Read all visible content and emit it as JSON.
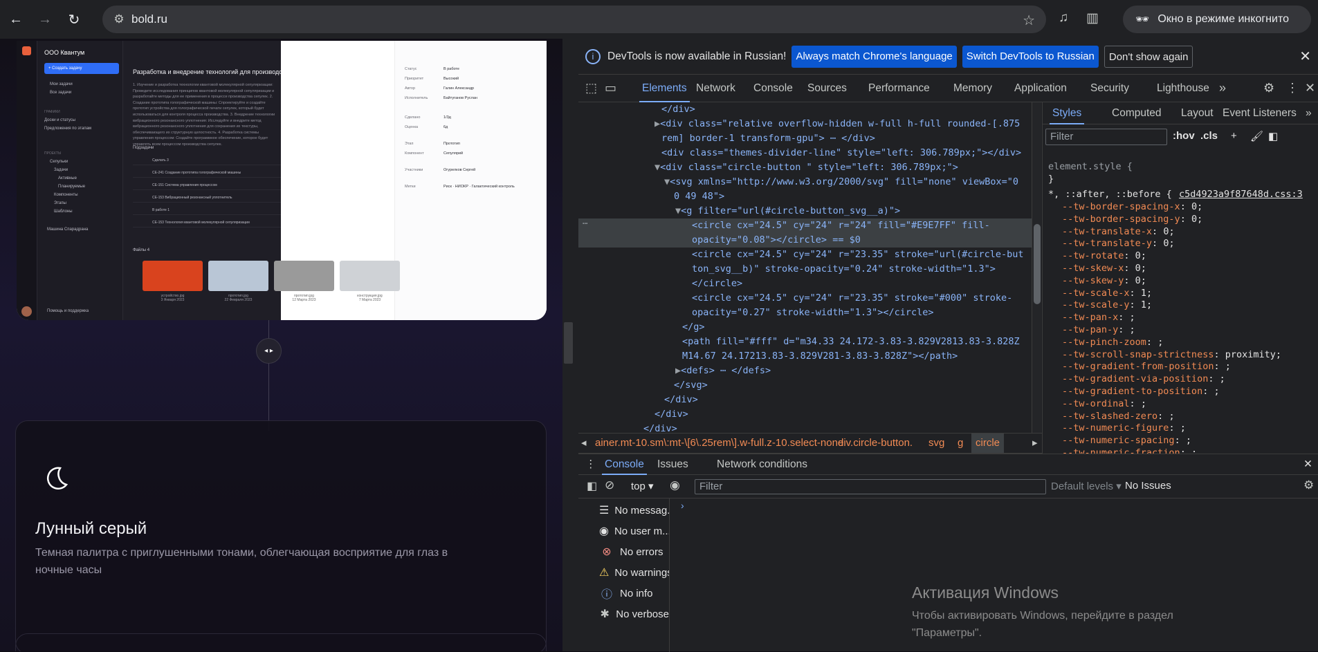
{
  "browser": {
    "url": "bold.ru",
    "incognito_label": "Окно в режиме инкогнито"
  },
  "page": {
    "preview": {
      "org_name": "ООО Квантум",
      "create_task": "+ Создать задачу",
      "sidebar_items": [
        "Мои задачи",
        "Все задачи"
      ],
      "sidebar_sec1": "ГРАФИКИ",
      "sidebar_items2": [
        "Доски и статусы",
        "Предложения по этапам"
      ],
      "sidebar_sec2": "ПРОЕКТЫ",
      "sidebar_items3": [
        "Сепульки",
        "Задачи",
        "Активные",
        "Планируемые",
        "Компоненты",
        "Этапы",
        "Шаблоны",
        "Машина Спарадрана"
      ],
      "task_title": "Разработка и внедрение технологий для производства сепулек в сепуляриях",
      "task_text": "1. Изучение и разработка технологии квантовой молекулярной сепуляризации: Проведите исследования принципов квантовой молекулярной сепуляризации и разработайте методы для ее применения в процессе производства сепулек. 2. Создание прототипа голографической машины: Спроектируйте и создайте прототип устройства для голографической печати сепулек, который будет использоваться для контроля процесса производства. 3. Внедрение технологии вибрационного резонансного уплотнения: Исследуйте и внедрите метод вибрационного резонансного уплотнения для сохранения их текстуры, обеспечивающего их структурную целостность. 4. Разработка системы управления процессом: Создайте программное обеспечение, которое будет управлять всем процессом производства сепулек.",
      "subtasks_label": "Подзадачи",
      "subtasks": [
        "Сделать 3",
        "СЕ-241  Создание прототипа голографической машины",
        "СЕ-151  Система управления процессом",
        "СЕ-153  Вибрационный резонансный уплотнитель",
        "В работе 1",
        "СЕ-153  Технология квантовой молекулярной сепуляризации"
      ],
      "files_label": "Файлы 4",
      "files": [
        {
          "name": "устройство.jpg",
          "date": "3 Января 2023",
          "color": "#d9431e"
        },
        {
          "name": "прототип.jpg",
          "date": "22 Февраля 2023",
          "color": "#b9c6d6"
        },
        {
          "name": "прототип.jpg",
          "date": "12 Марта 2023",
          "color": "#9a9a9a"
        },
        {
          "name": "конструкция.jpg",
          "date": "7 Марта 2023",
          "color": "#cfd2d6"
        }
      ],
      "props": [
        {
          "k": "Статус",
          "v": "В работе"
        },
        {
          "k": "Приоритет",
          "v": "Высокий"
        },
        {
          "k": "Автор",
          "v": "Галин Александр"
        },
        {
          "k": "Исполнитель",
          "v": "Байтуганов Руслан"
        },
        {
          "k": "Сделано",
          "v": "1/3д"
        },
        {
          "k": "Оценка",
          "v": "6д"
        },
        {
          "k": "Этап",
          "v": "Прототип"
        },
        {
          "k": "Компонент",
          "v": "Сепулярий"
        },
        {
          "k": "Участники",
          "v": "Огурелков Сергей"
        },
        {
          "k": "Метки",
          "v": "Риск · НИОКР · Галактический контроль"
        }
      ],
      "support": "Помощь и поддержка"
    },
    "theme_card": {
      "title": "Лунный серый",
      "description": "Темная палитра с приглушенными тонами, облегчающая восприятие для глаз в ночные часы"
    }
  },
  "devtools": {
    "infobar": {
      "message": "DevTools is now available in Russian!",
      "btn_match": "Always match Chrome's language",
      "btn_switch": "Switch DevTools to Russian",
      "btn_dismiss": "Don't show again"
    },
    "tabs": [
      "Elements",
      "Network",
      "Console",
      "Sources",
      "Performance",
      "Memory",
      "Application",
      "Security",
      "Lighthouse"
    ],
    "active_tab": "Elements",
    "dom_lines": [
      "</div>",
      "<div class=\"relative overflow-hidden w-full h-full rounded-[.875",
      "rem] border-1 transform-gpu\"> ⋯ </div>",
      "<div class=\"themes-divider-line\" style=\"left: 306.789px;\"></div>",
      "<div class=\"circle-button \" style=\"left: 306.789px;\">",
      "<svg xmlns=\"http://www.w3.org/2000/svg\" fill=\"none\" viewBox=\"0",
      "0 49 48\">",
      "<g filter=\"url(#circle-button_svg__a)\">",
      "<circle cx=\"24.5\" cy=\"24\" r=\"24\" fill=\"#E9E7FF\" fill-",
      "opacity=\"0.08\"></circle> == $0",
      "<circle cx=\"24.5\" cy=\"24\" r=\"23.35\" stroke=\"url(#circle-but",
      "ton_svg__b)\" stroke-opacity=\"0.24\" stroke-width=\"1.3\">",
      "</circle>",
      "<circle cx=\"24.5\" cy=\"24\" r=\"23.35\" stroke=\"#000\" stroke-",
      "opacity=\"0.27\" stroke-width=\"1.3\"></circle>",
      "</g>",
      "<path fill=\"#fff\" d=\"m34.33 24.172-3.83-3.829V2813.83-3.828Z",
      "M14.67 24.17213.83-3.829V281-3.83-3.828Z\"></path>",
      "<defs> ⋯ </defs>",
      "</svg>",
      "</div>",
      "</div>",
      "</div>"
    ],
    "breadcrumbs": [
      "ainer.mt-10.sm\\:mt-\\[6\\.25rem\\].w-full.z-10.select-none",
      "div.circle-button.",
      "svg",
      "g",
      "circle"
    ],
    "styles": {
      "tabs": [
        "Styles",
        "Computed",
        "Layout",
        "Event Listeners"
      ],
      "filter_placeholder": "Filter",
      "hov": ":hov",
      "cls": ".cls",
      "element_style": "element.style {",
      "element_close": "}",
      "selector": "*, ::after, ::before {",
      "source": "c5d4923a9f87648d.css:3",
      "props": [
        [
          "--tw-border-spacing-x",
          "0;"
        ],
        [
          "--tw-border-spacing-y",
          "0;"
        ],
        [
          "--tw-translate-x",
          "0;"
        ],
        [
          "--tw-translate-y",
          "0;"
        ],
        [
          "--tw-rotate",
          "0;"
        ],
        [
          "--tw-skew-x",
          "0;"
        ],
        [
          "--tw-skew-y",
          "0;"
        ],
        [
          "--tw-scale-x",
          "1;"
        ],
        [
          "--tw-scale-y",
          "1;"
        ],
        [
          "--tw-pan-x",
          ";"
        ],
        [
          "--tw-pan-y",
          ";"
        ],
        [
          "--tw-pinch-zoom",
          ";"
        ],
        [
          "--tw-scroll-snap-strictness",
          "proximity;"
        ],
        [
          "--tw-gradient-from-position",
          ";"
        ],
        [
          "--tw-gradient-via-position",
          ";"
        ],
        [
          "--tw-gradient-to-position",
          ";"
        ],
        [
          "--tw-ordinal",
          ";"
        ],
        [
          "--tw-slashed-zero",
          ";"
        ],
        [
          "--tw-numeric-figure",
          ";"
        ],
        [
          "--tw-numeric-spacing",
          ";"
        ],
        [
          "--tw-numeric-fraction",
          ";"
        ]
      ]
    },
    "console": {
      "tabs": [
        "Console",
        "Issues",
        "Network conditions"
      ],
      "context": "top",
      "filter_placeholder": "Filter",
      "levels": "Default levels ▾",
      "issues": "No Issues",
      "sidebar": [
        {
          "icon": "list-icon",
          "glyph": "☰",
          "label": "No messag...",
          "color": "#e3e3e3"
        },
        {
          "icon": "user-icon",
          "glyph": "◉",
          "label": "No user m...",
          "color": "#e3e3e3"
        },
        {
          "icon": "error-icon",
          "glyph": "⊗",
          "label": "No errors",
          "color": "#f28b82"
        },
        {
          "icon": "warning-icon",
          "glyph": "⚠",
          "label": "No warnings",
          "color": "#fdd663"
        },
        {
          "icon": "info-icon",
          "glyph": "ⓘ",
          "label": "No info",
          "color": "#8ab4f8"
        },
        {
          "icon": "bug-icon",
          "glyph": "✱",
          "label": "No verbose",
          "color": "#c4c7c5"
        }
      ]
    }
  },
  "watermark": {
    "title": "Активация Windows",
    "text": "Чтобы активировать Windows, перейдите в раздел \"Параметры\"."
  }
}
